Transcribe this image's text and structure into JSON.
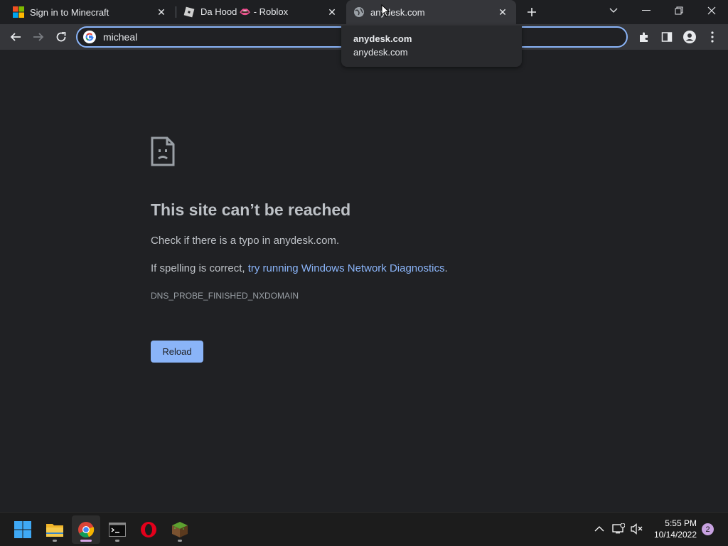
{
  "tabs": [
    {
      "title": "Sign in to Minecraft",
      "favicon": "microsoft-icon"
    },
    {
      "title": "Da Hood 👄 - Roblox",
      "favicon": "roblox-icon"
    },
    {
      "title": "anydesk.com",
      "favicon": "globe-icon",
      "active": true
    }
  ],
  "omnibox": {
    "value": "micheal"
  },
  "hovercard": {
    "title": "anydesk.com",
    "domain": "anydesk.com"
  },
  "error": {
    "title": "This site can’t be reached",
    "line1": "Check if there is a typo in anydesk.com.",
    "line2_prefix": "If spelling is correct, ",
    "line2_link": "try running Windows Network Diagnostics",
    "line2_suffix": ".",
    "code": "DNS_PROBE_FINISHED_NXDOMAIN",
    "reload_label": "Reload"
  },
  "taskbar": {
    "apps": [
      "start-icon",
      "file-explorer-icon",
      "chrome-icon",
      "terminal-icon",
      "opera-icon",
      "minecraft-icon"
    ],
    "time": "5:55 PM",
    "date": "10/14/2022",
    "notification_count": "2"
  },
  "colors": {
    "accent": "#8ab4f8",
    "page_bg": "#202124",
    "toolbar_bg": "#35363a"
  }
}
